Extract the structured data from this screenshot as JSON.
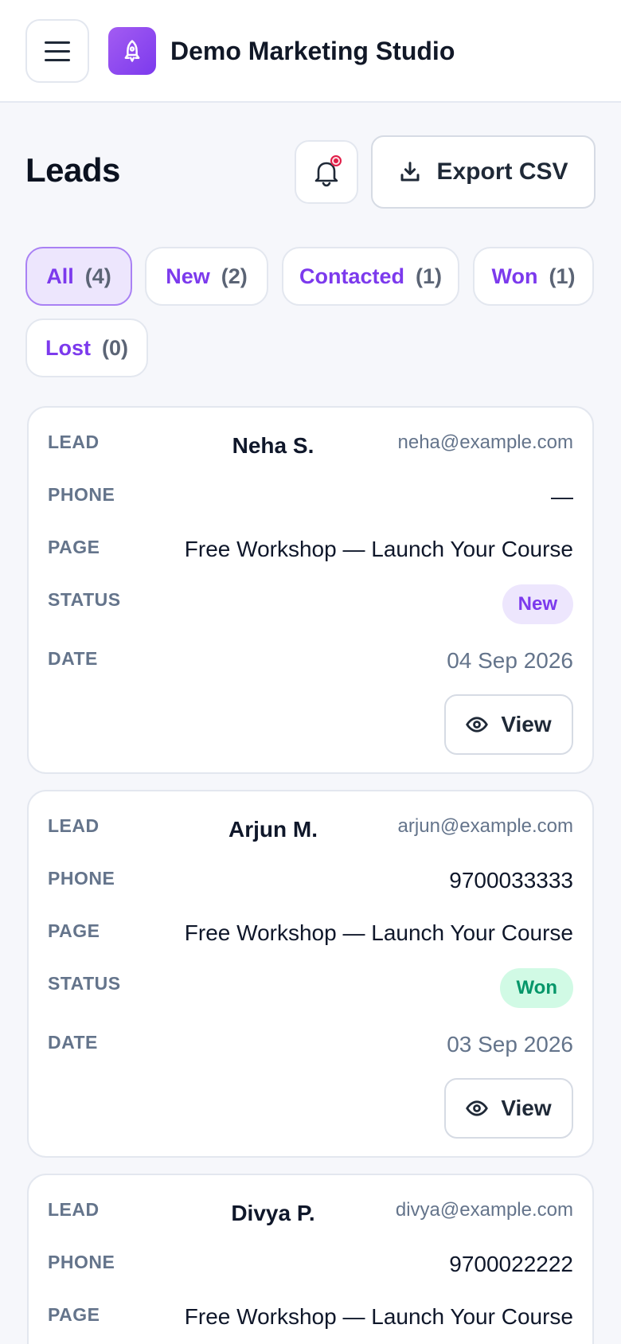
{
  "header": {
    "brand": "Demo Marketing Studio",
    "menu_icon": "hamburger-icon",
    "logo_icon": "rocket-icon"
  },
  "page": {
    "title": "Leads",
    "export_label": "Export CSV"
  },
  "colors": {
    "accent": "#7c3aed",
    "won": "#059669",
    "notification_dot": "#e11d48"
  },
  "filters": [
    {
      "label": "All",
      "count": "(4)",
      "active": true
    },
    {
      "label": "New",
      "count": "(2)",
      "active": false
    },
    {
      "label": "Contacted",
      "count": "(1)",
      "active": false
    },
    {
      "label": "Won",
      "count": "(1)",
      "active": false
    },
    {
      "label": "Lost",
      "count": "(0)",
      "active": false
    }
  ],
  "labels": {
    "lead": "LEAD",
    "phone": "PHONE",
    "page": "PAGE",
    "status": "STATUS",
    "date": "DATE",
    "view": "View"
  },
  "leads": [
    {
      "name": "Neha S.",
      "email": "neha@example.com",
      "phone": "—",
      "page": "Free Workshop — Launch Your Course",
      "status": "New",
      "date": "04 Sep 2026"
    },
    {
      "name": "Arjun M.",
      "email": "arjun@example.com",
      "phone": "9700033333",
      "page": "Free Workshop — Launch Your Course",
      "status": "Won",
      "date": "03 Sep 2026"
    },
    {
      "name": "Divya P.",
      "email": "divya@example.com",
      "phone": "9700022222",
      "page": "Free Workshop — Launch Your Course"
    }
  ]
}
